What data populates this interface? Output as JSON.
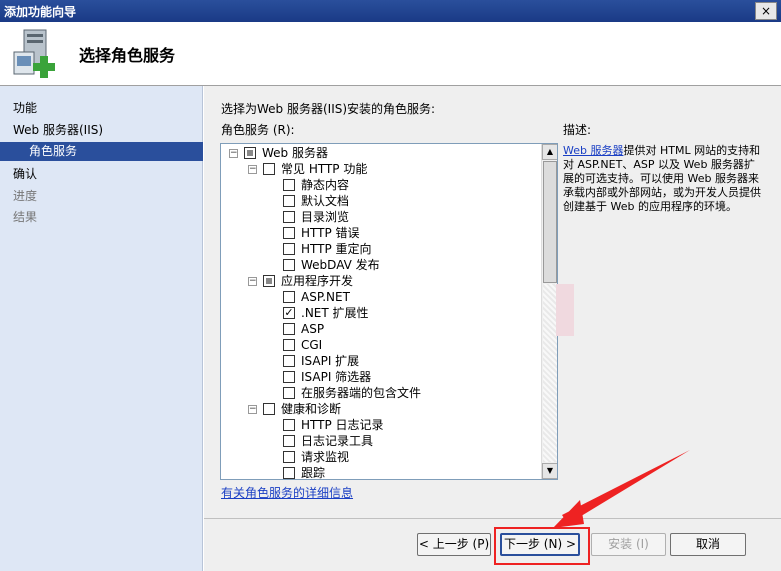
{
  "window": {
    "title": "添加功能向导",
    "close_label": "×"
  },
  "header": {
    "heading": "选择角色服务"
  },
  "sidebar": {
    "items": [
      {
        "label": "功能"
      },
      {
        "label": "Web 服务器(IIS)"
      },
      {
        "label": "角色服务"
      },
      {
        "label": "确认"
      },
      {
        "label": "进度"
      },
      {
        "label": "结果"
      }
    ]
  },
  "content": {
    "instruction": "选择为Web 服务器(IIS)安装的角色服务:",
    "list_label": "角色服务 (R):",
    "desc_label": "描述:",
    "desc_link": "Web 服务器",
    "desc_text": "提供对 HTML 网站的支持和对 ASP.NET、ASP 以及 Web 服务器扩展的可选支持。可以使用 Web 服务器来承载内部或外部网站，或为开发人员提供创建基于 Web 的应用程序的环境。",
    "detail_link": "有关角色服务的详细信息"
  },
  "tree": [
    {
      "label": "Web 服务器",
      "level": 0,
      "state": "partial",
      "expander": "⊟"
    },
    {
      "label": "常见 HTTP 功能",
      "level": 1,
      "state": "unchecked",
      "expander": "⊟"
    },
    {
      "label": "静态内容",
      "level": 2,
      "state": "unchecked"
    },
    {
      "label": "默认文档",
      "level": 2,
      "state": "unchecked"
    },
    {
      "label": "目录浏览",
      "level": 2,
      "state": "unchecked"
    },
    {
      "label": "HTTP 错误",
      "level": 2,
      "state": "unchecked"
    },
    {
      "label": "HTTP 重定向",
      "level": 2,
      "state": "unchecked"
    },
    {
      "label": "WebDAV 发布",
      "level": 2,
      "state": "unchecked"
    },
    {
      "label": "应用程序开发",
      "level": 1,
      "state": "partial",
      "expander": "⊟"
    },
    {
      "label": "ASP.NET",
      "level": 2,
      "state": "unchecked"
    },
    {
      "label": ".NET 扩展性",
      "level": 2,
      "state": "checked"
    },
    {
      "label": "ASP",
      "level": 2,
      "state": "unchecked"
    },
    {
      "label": "CGI",
      "level": 2,
      "state": "unchecked"
    },
    {
      "label": "ISAPI 扩展",
      "level": 2,
      "state": "unchecked"
    },
    {
      "label": "ISAPI 筛选器",
      "level": 2,
      "state": "unchecked"
    },
    {
      "label": "在服务器端的包含文件",
      "level": 2,
      "state": "unchecked"
    },
    {
      "label": "健康和诊断",
      "level": 1,
      "state": "unchecked",
      "expander": "⊟"
    },
    {
      "label": "HTTP 日志记录",
      "level": 2,
      "state": "unchecked"
    },
    {
      "label": "日志记录工具",
      "level": 2,
      "state": "unchecked"
    },
    {
      "label": "请求监视",
      "level": 2,
      "state": "unchecked"
    },
    {
      "label": "跟踪",
      "level": 2,
      "state": "unchecked"
    }
  ],
  "footer": {
    "back": "< 上一步 (P)",
    "next": "下一步 (N) >",
    "install": "安装 (I)",
    "cancel": "取消"
  },
  "colors": {
    "accent": "#2a4f9c",
    "highlight": "#e22222"
  }
}
